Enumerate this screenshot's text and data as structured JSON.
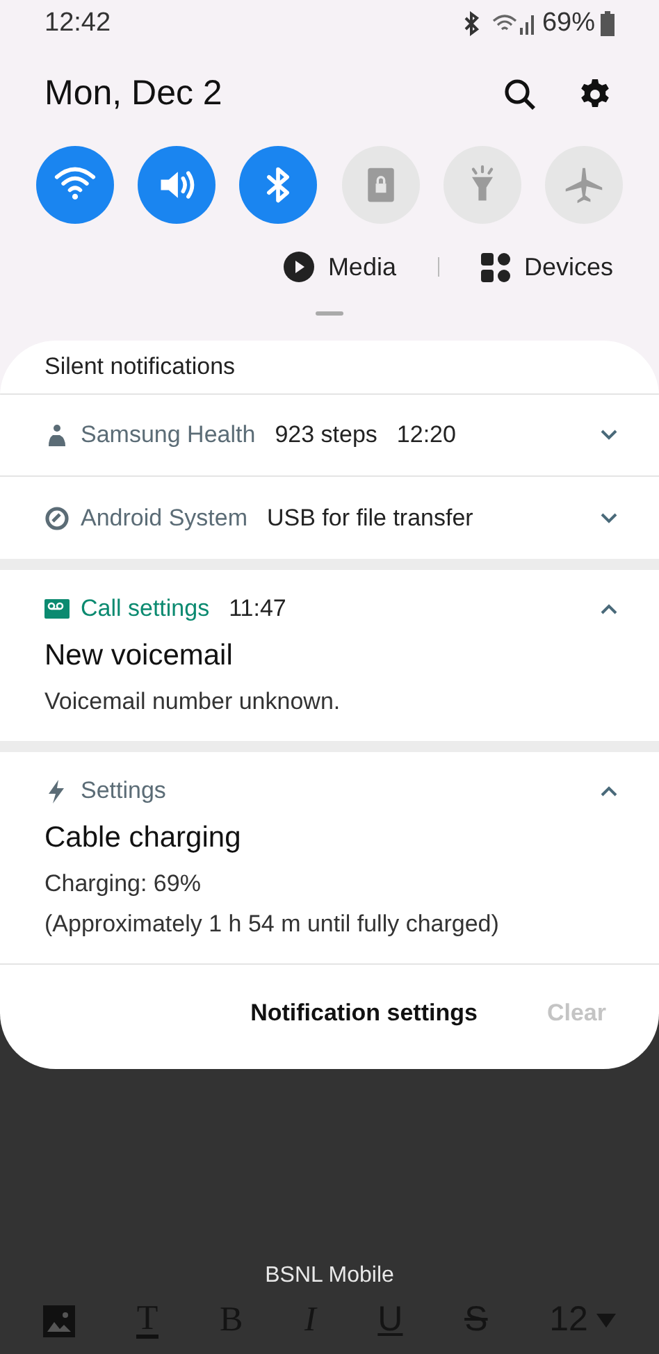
{
  "status_bar": {
    "time": "12:42",
    "battery": "69%"
  },
  "header": {
    "date": "Mon, Dec 2"
  },
  "quick_toggles": [
    {
      "kind": "wifi",
      "on": true
    },
    {
      "kind": "sound",
      "on": true
    },
    {
      "kind": "bluetooth",
      "on": true
    },
    {
      "kind": "lock",
      "on": false
    },
    {
      "kind": "flashlight",
      "on": false
    },
    {
      "kind": "airplane",
      "on": false
    }
  ],
  "media_button": "Media",
  "devices_button": "Devices",
  "silent_header": "Silent notifications",
  "silent_notifications": [
    {
      "kind": "health",
      "app": "Samsung Health",
      "text": "923 steps",
      "time": "12:20",
      "expanded": false
    },
    {
      "kind": "system",
      "app": "Android System",
      "text": "USB for file transfer",
      "expanded": false
    }
  ],
  "notifications": [
    {
      "kind": "voicemail",
      "app": "Call settings",
      "color": "#0b8a70",
      "time": "11:47",
      "title": "New voicemail",
      "lines": [
        "Voicemail number unknown."
      ],
      "expanded": true
    },
    {
      "kind": "charging",
      "app": "Settings",
      "color": "#5b6c76",
      "title": "Cable charging",
      "lines": [
        "Charging: 69%",
        "(Approximately 1 h 54 m until fully charged)"
      ],
      "expanded": true
    }
  ],
  "footer": {
    "settings_button": "Notification settings",
    "clear_button": {
      "label": "Clear",
      "disabled": true
    }
  },
  "carrier": "BSNL Mobile",
  "editor_toolbar": [
    {
      "kind": "image"
    },
    {
      "kind": "text_color",
      "label": "T"
    },
    {
      "kind": "bold",
      "label": "B"
    },
    {
      "kind": "italic",
      "label": "I"
    },
    {
      "kind": "underline",
      "label": "U"
    },
    {
      "kind": "strike",
      "label": "S"
    },
    {
      "kind": "size",
      "label": "12"
    }
  ]
}
